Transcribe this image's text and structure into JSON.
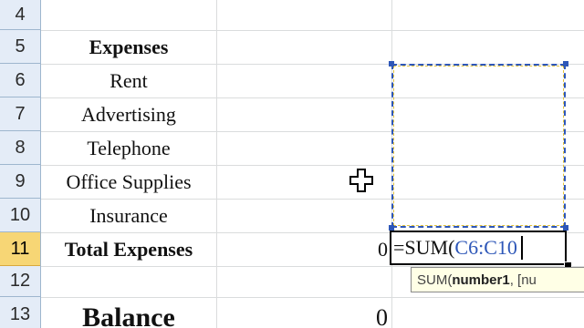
{
  "rows": [
    {
      "number": "4"
    },
    {
      "number": "5"
    },
    {
      "number": "6"
    },
    {
      "number": "7"
    },
    {
      "number": "8"
    },
    {
      "number": "9"
    },
    {
      "number": "10"
    },
    {
      "number": "11"
    },
    {
      "number": "12"
    },
    {
      "number": "13"
    }
  ],
  "labels": {
    "expenses_header": "Expenses",
    "rent": "Rent",
    "advertising": "Advertising",
    "telephone": "Telephone",
    "office_supplies": "Office Supplies",
    "insurance": "Insurance",
    "total_expenses": "Total Expenses",
    "balance": "Balance"
  },
  "values": {
    "total_expenses_b": "0",
    "balance_b": "0"
  },
  "formula": {
    "prefix": "=SUM(",
    "range": "C6:C10"
  },
  "tooltip": {
    "fn": "SUM(",
    "arg1": "number1",
    "rest": ", [nu"
  },
  "active_row": "11",
  "colors": {
    "range_highlight": "#2e57b8",
    "active_header": "#f7d675",
    "row_header_bg": "#e4ecf7",
    "tooltip_bg": "#ffffe6"
  }
}
